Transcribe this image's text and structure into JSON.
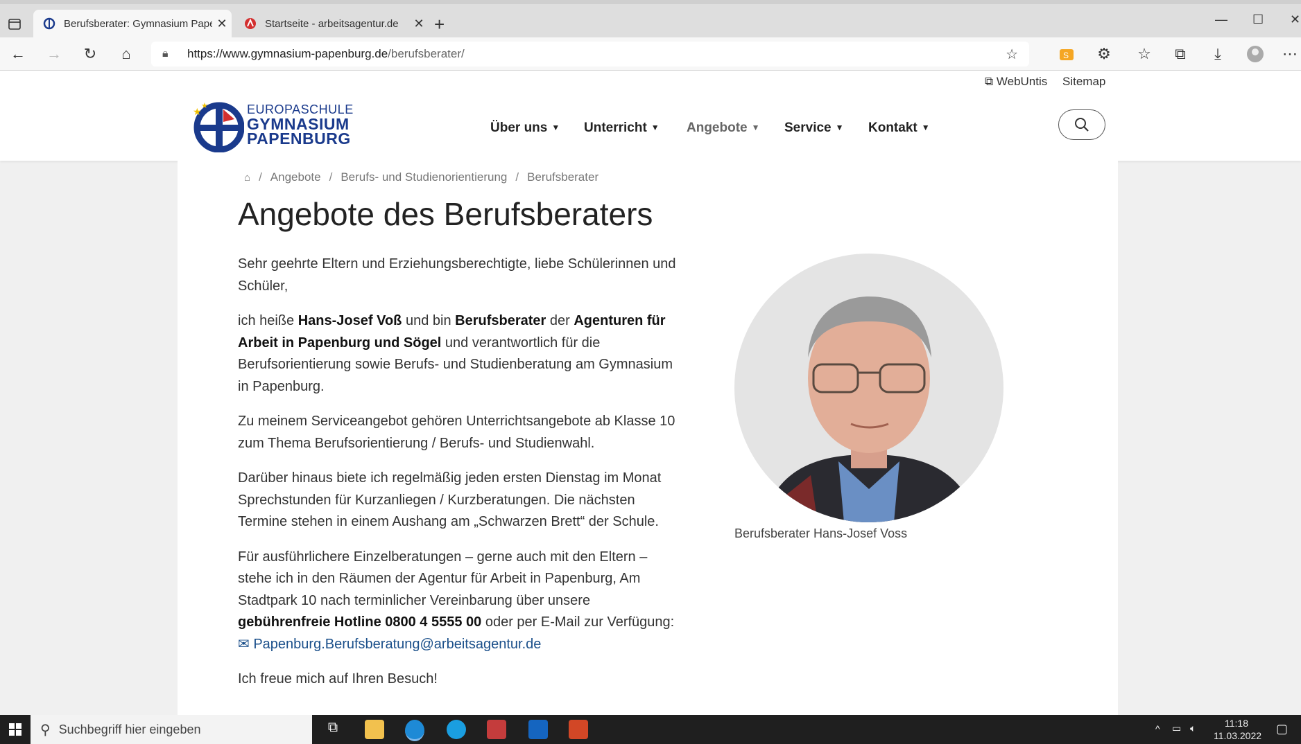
{
  "browser": {
    "tabs": [
      {
        "title": "Berufsberater: Gymnasium Paper",
        "active": true
      },
      {
        "title": "Startseite - arbeitsagentur.de",
        "active": false
      }
    ],
    "url_host": "https://www.gymnasium-papenburg.de",
    "url_path": "/berufsberater/"
  },
  "site": {
    "toplinks": {
      "webuntis": "WebUntis",
      "sitemap": "Sitemap"
    },
    "logo": {
      "line1": "EUROPASCHULE",
      "line2": "GYMNASIUM",
      "line3": "PAPENBURG"
    },
    "nav": [
      "Über uns",
      "Unterricht",
      "Angebote",
      "Service",
      "Kontakt"
    ]
  },
  "breadcrumb": [
    "Angebote",
    "Berufs- und Studienorientierung",
    "Berufsberater"
  ],
  "main": {
    "title": "Angebote des Berufsberaters",
    "p1": "Sehr geehrte Eltern und Erziehungsberechtigte, liebe Schülerinnen und Schüler,",
    "p2_a": "ich heiße ",
    "p2_name": "Hans-Josef Voß",
    "p2_b": " und bin ",
    "p2_role": "Berufsberater",
    "p2_c": " der ",
    "p2_agency": "Agenturen für Arbeit in Papenburg und Sögel",
    "p2_d": " und verantwortlich für die Berufsorientierung sowie Berufs- und Studienberatung am Gymnasium in Papenburg.",
    "p3": "Zu meinem Serviceangebot gehören Unterrichtsangebote ab Klasse 10 zum Thema Berufsorientierung / Berufs- und Studienwahl.",
    "p4": "Darüber hinaus biete ich regelmäßig jeden ersten Dienstag im Monat Sprechstunden für Kurzanliegen / Kurzberatungen. Die nächsten Termine stehen in einem Aushang am „Schwarzen Brett“ der Schule.",
    "p5_a": "Für ausführlichere Einzelberatungen – gerne auch mit den Eltern – stehe ich in den Räumen der Agentur für Arbeit in Papenburg, Am Stadtpark 10 nach terminlicher Vereinbarung über unsere ",
    "p5_hotline": "gebührenfreie Hotline 0800 4 5555 00",
    "p5_b": " oder per E-Mail zur Verfügung: ",
    "email": "Papenburg.Berufsberatung@arbeitsagentur.de",
    "p6": "Ich freue mich auf Ihren Besuch!",
    "photo_caption": "Berufsberater Hans-Josef Voss"
  },
  "taskbar": {
    "search_placeholder": "Suchbegriff hier eingeben",
    "time": "11:18",
    "date": "11.03.2022"
  },
  "colors": {
    "brand": "#1a3a8c",
    "link": "#1a4f8a",
    "taskbar": "#1f1f1f"
  }
}
